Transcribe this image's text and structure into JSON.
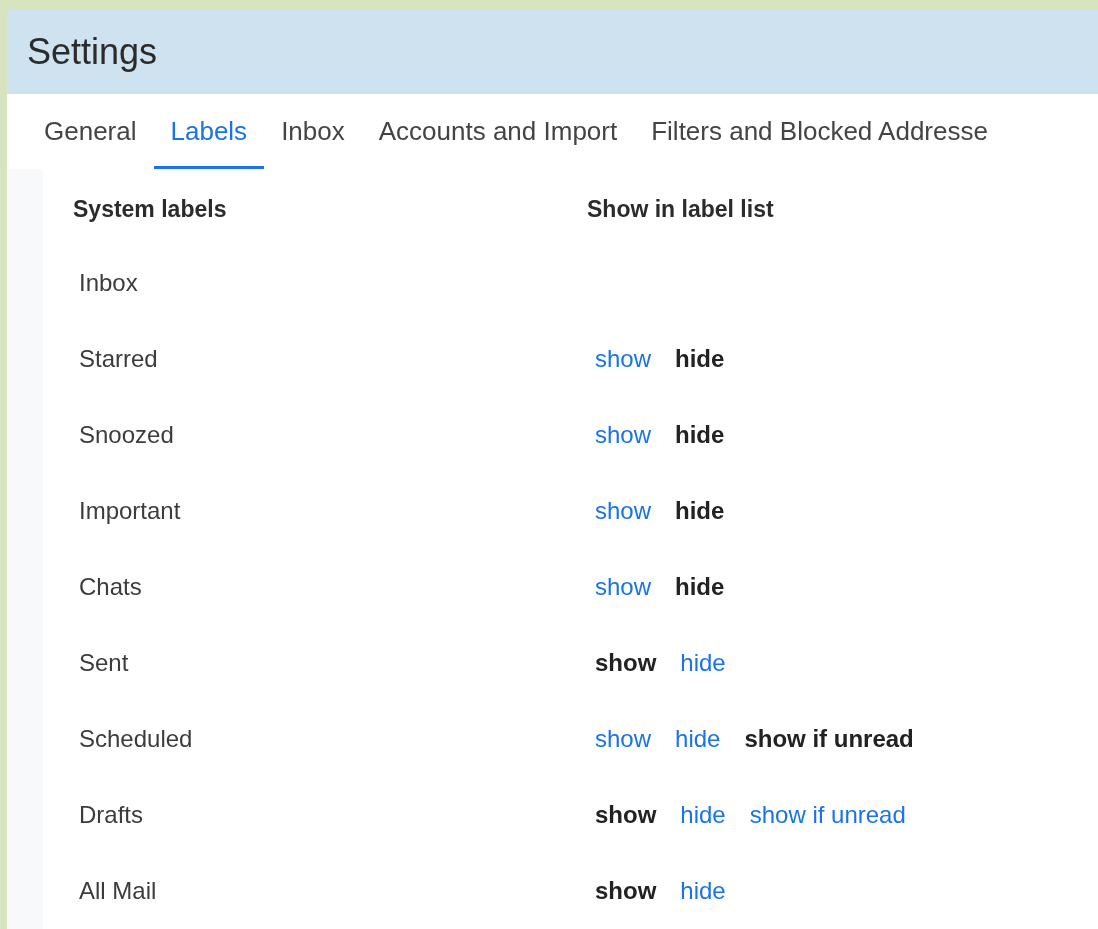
{
  "window": {
    "title": "Settings"
  },
  "tabs": [
    {
      "label": "General",
      "selected": false
    },
    {
      "label": "Labels",
      "selected": true
    },
    {
      "label": "Inbox",
      "selected": false
    },
    {
      "label": "Accounts and Import",
      "selected": false
    },
    {
      "label": "Filters and Blocked Addresse",
      "selected": false
    }
  ],
  "table": {
    "columns": [
      "System labels",
      "Show in label list"
    ],
    "rows": [
      {
        "label": "Inbox",
        "options": []
      },
      {
        "label": "Starred",
        "options": [
          {
            "text": "show",
            "selected": false
          },
          {
            "text": "hide",
            "selected": true
          }
        ]
      },
      {
        "label": "Snoozed",
        "options": [
          {
            "text": "show",
            "selected": false
          },
          {
            "text": "hide",
            "selected": true
          }
        ]
      },
      {
        "label": "Important",
        "options": [
          {
            "text": "show",
            "selected": false
          },
          {
            "text": "hide",
            "selected": true
          }
        ]
      },
      {
        "label": "Chats",
        "options": [
          {
            "text": "show",
            "selected": false
          },
          {
            "text": "hide",
            "selected": true
          }
        ]
      },
      {
        "label": "Sent",
        "options": [
          {
            "text": "show",
            "selected": true
          },
          {
            "text": "hide",
            "selected": false
          }
        ]
      },
      {
        "label": "Scheduled",
        "options": [
          {
            "text": "show",
            "selected": false
          },
          {
            "text": "hide",
            "selected": false
          },
          {
            "text": "show if unread",
            "selected": true
          }
        ]
      },
      {
        "label": "Drafts",
        "options": [
          {
            "text": "show",
            "selected": true
          },
          {
            "text": "hide",
            "selected": false
          },
          {
            "text": "show if unread",
            "selected": false
          }
        ]
      },
      {
        "label": "All Mail",
        "options": [
          {
            "text": "show",
            "selected": true
          },
          {
            "text": "hide",
            "selected": false
          }
        ]
      }
    ]
  }
}
